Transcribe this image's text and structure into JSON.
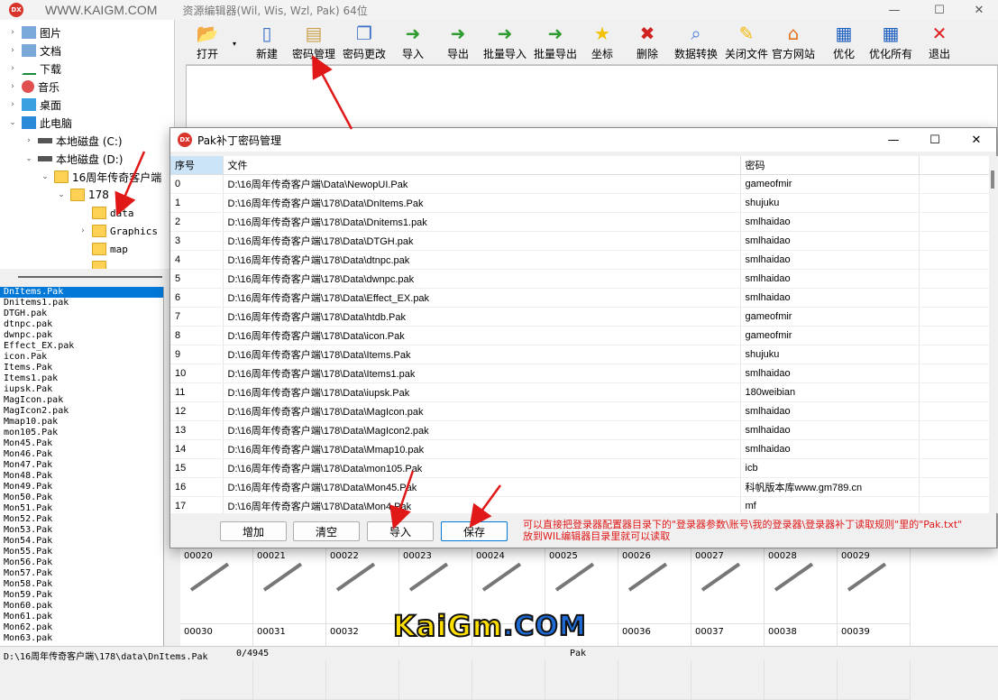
{
  "window": {
    "site": "WWW.KAIGM.COM",
    "title": "资源编辑器(Wil, Wis, Wzl, Pak)  64位",
    "app_icon": "DX"
  },
  "tree": [
    {
      "label": "图片",
      "arrow": "›",
      "icon": "pictures-icon"
    },
    {
      "label": "文档",
      "arrow": "›",
      "icon": "documents-icon"
    },
    {
      "label": "下载",
      "arrow": "›",
      "icon": "download-icon"
    },
    {
      "label": "音乐",
      "arrow": "›",
      "icon": "music-icon"
    },
    {
      "label": "桌面",
      "arrow": "›",
      "icon": "desktop-icon"
    },
    {
      "label": "此电脑",
      "arrow": "⌄",
      "icon": "computer-icon"
    },
    {
      "label": "本地磁盘 (C:)",
      "arrow": "›",
      "icon": "drive-icon"
    },
    {
      "label": "本地磁盘 (D:)",
      "arrow": "⌄",
      "icon": "drive-icon"
    },
    {
      "label": "16周年传奇客户端",
      "arrow": "⌄",
      "icon": "folder-icon"
    },
    {
      "label": "178",
      "arrow": "⌄",
      "icon": "folder-icon"
    },
    {
      "label": "data",
      "arrow": "",
      "icon": "folder-icon"
    },
    {
      "label": "Graphics",
      "arrow": "›",
      "icon": "folder-icon"
    },
    {
      "label": "map",
      "arrow": "",
      "icon": "folder-icon"
    },
    {
      "label": "...",
      "arrow": "",
      "icon": "folder-icon"
    }
  ],
  "files": [
    "DnItems.Pak",
    "Dnitems1.pak",
    "DTGH.pak",
    "dtnpc.pak",
    "dwnpc.pak",
    "Effect_EX.pak",
    "icon.Pak",
    "Items.Pak",
    "Items1.pak",
    "iupsk.Pak",
    "MagIcon.pak",
    "MagIcon2.pak",
    "Mmap10.pak",
    "mon105.Pak",
    "Mon45.Pak",
    "Mon46.Pak",
    "Mon47.Pak",
    "Mon48.Pak",
    "Mon49.Pak",
    "Mon50.Pak",
    "Mon51.Pak",
    "Mon52.Pak",
    "Mon53.Pak",
    "Mon54.Pak",
    "Mon55.Pak",
    "Mon56.Pak",
    "Mon57.Pak",
    "Mon58.Pak",
    "Mon59.Pak",
    "Mon60.pak",
    "Mon61.pak",
    "Mon62.pak",
    "Mon63.pak"
  ],
  "toolbar": [
    {
      "label": "打开",
      "icon": "open-folder-icon",
      "color": "#f2b705"
    },
    {
      "label": "新建",
      "icon": "new-file-icon",
      "color": "#4a7fd4"
    },
    {
      "label": "密码管理",
      "icon": "clipboard-icon",
      "color": "#c9a14a"
    },
    {
      "label": "密码更改",
      "icon": "copy-icon",
      "color": "#4a7fd4"
    },
    {
      "label": "导入",
      "icon": "import-icon",
      "color": "#2e9b2e"
    },
    {
      "label": "导出",
      "icon": "export-icon",
      "color": "#2e9b2e"
    },
    {
      "label": "批量导入",
      "icon": "batch-import-icon",
      "color": "#2e9b2e"
    },
    {
      "label": "批量导出",
      "icon": "batch-export-icon",
      "color": "#2e9b2e"
    },
    {
      "label": "坐标",
      "icon": "star-icon",
      "color": "#f2c200"
    },
    {
      "label": "删除",
      "icon": "delete-icon",
      "color": "#d02020"
    },
    {
      "label": "数据转换",
      "icon": "search-doc-icon",
      "color": "#4a7fd4"
    },
    {
      "label": "关闭文件",
      "icon": "close-file-icon",
      "color": "#f2b705"
    },
    {
      "label": "官方网站",
      "icon": "home-icon",
      "color": "#e07020"
    },
    {
      "label": "优化",
      "icon": "grid-icon",
      "color": "#2060c0"
    },
    {
      "label": "优化所有",
      "icon": "grid-all-icon",
      "color": "#2060c0"
    },
    {
      "label": "退出",
      "icon": "exit-icon",
      "color": "#e02020"
    }
  ],
  "grid": {
    "row1": [
      "00020",
      "00021",
      "00022",
      "00023",
      "00024",
      "00025",
      "00026",
      "00027",
      "00028",
      "00029"
    ],
    "row2": [
      "00030",
      "00031",
      "00032",
      "",
      "",
      "",
      "00036",
      "00037",
      "00038",
      "00039"
    ]
  },
  "status": {
    "path": "D:\\16周年传奇客户端\\178\\data\\DnItems.Pak",
    "count": "0/4945",
    "type": "Pak"
  },
  "dialog": {
    "title": "Pak补丁密码管理",
    "headers": [
      "序号",
      "文件",
      "密码"
    ],
    "rows": [
      [
        "0",
        "D:\\16周年传奇客户端\\Data\\NewopUI.Pak",
        "gameofmir"
      ],
      [
        "1",
        "D:\\16周年传奇客户端\\178\\Data\\DnItems.Pak",
        "shujuku"
      ],
      [
        "2",
        "D:\\16周年传奇客户端\\178\\Data\\Dnitems1.pak",
        "smlhaidao"
      ],
      [
        "3",
        "D:\\16周年传奇客户端\\178\\Data\\DTGH.pak",
        "smlhaidao"
      ],
      [
        "4",
        "D:\\16周年传奇客户端\\178\\Data\\dtnpc.pak",
        "smlhaidao"
      ],
      [
        "5",
        "D:\\16周年传奇客户端\\178\\Data\\dwnpc.pak",
        "smlhaidao"
      ],
      [
        "6",
        "D:\\16周年传奇客户端\\178\\Data\\Effect_EX.pak",
        "smlhaidao"
      ],
      [
        "7",
        "D:\\16周年传奇客户端\\178\\Data\\htdb.Pak",
        "gameofmir"
      ],
      [
        "8",
        "D:\\16周年传奇客户端\\178\\Data\\icon.Pak",
        "gameofmir"
      ],
      [
        "9",
        "D:\\16周年传奇客户端\\178\\Data\\Items.Pak",
        "shujuku"
      ],
      [
        "10",
        "D:\\16周年传奇客户端\\178\\Data\\Items1.pak",
        "smlhaidao"
      ],
      [
        "11",
        "D:\\16周年传奇客户端\\178\\Data\\iupsk.Pak",
        "180weibian"
      ],
      [
        "12",
        "D:\\16周年传奇客户端\\178\\Data\\MagIcon.pak",
        "smlhaidao"
      ],
      [
        "13",
        "D:\\16周年传奇客户端\\178\\Data\\MagIcon2.pak",
        "smlhaidao"
      ],
      [
        "14",
        "D:\\16周年传奇客户端\\178\\Data\\Mmap10.pak",
        "smlhaidao"
      ],
      [
        "15",
        "D:\\16周年传奇客户端\\178\\Data\\mon105.Pak",
        "icb"
      ],
      [
        "16",
        "D:\\16周年传奇客户端\\178\\Data\\Mon45.Pak",
        "科帆版本库www.gm789.cn"
      ],
      [
        "17",
        "D:\\16周年传奇客户端\\178\\Data\\Mon4.Pak",
        "mf"
      ]
    ],
    "buttons": {
      "add": "增加",
      "clear": "清空",
      "import": "导入",
      "save": "保存"
    },
    "note_line1": "可以直接把登录器配置器目录下的\"登录器参数\\账号\\我的登录器\\登录器补丁读取规则\"里的\"Pak.txt\"",
    "note_line2": "放到WIL编辑器目录里就可以读取"
  },
  "watermark": {
    "part1": "KaiGm",
    "part2": ".COM"
  },
  "colors": {
    "accent": "#0078d7",
    "annotation": "#e01818"
  }
}
